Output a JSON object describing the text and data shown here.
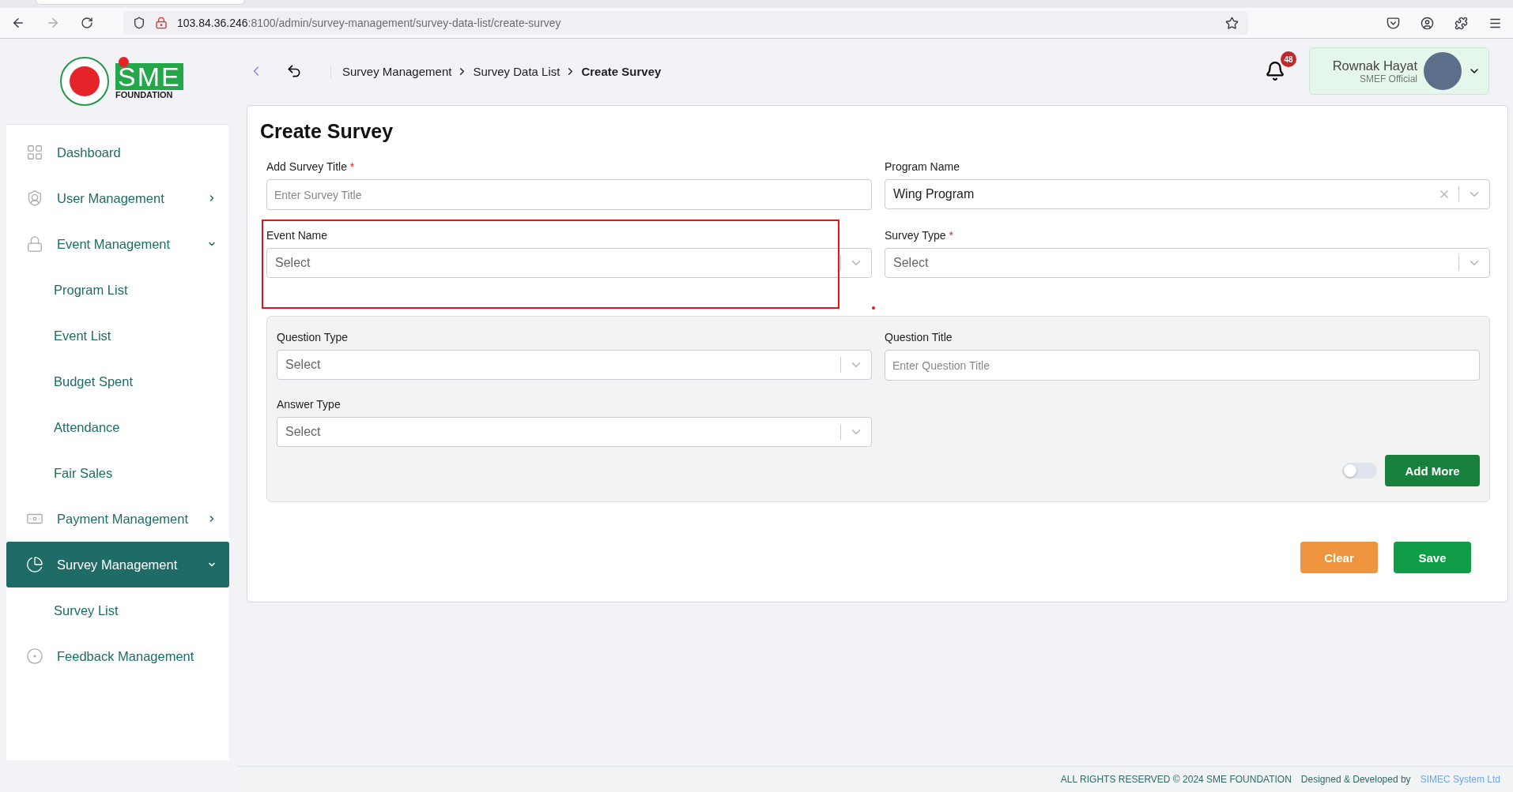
{
  "browser": {
    "url_host": "103.84.36.246",
    "url_rest": ":8100/admin/survey-management/survey-data-list/create-survey"
  },
  "logo": {
    "mark": "SME",
    "subtitle": "FOUNDATION"
  },
  "breadcrumb": [
    {
      "label": "Survey Management",
      "current": false
    },
    {
      "label": "Survey Data List",
      "current": false
    },
    {
      "label": "Create Survey",
      "current": true
    }
  ],
  "notifications": {
    "count": "48"
  },
  "user": {
    "name": "Rownak Hayat",
    "role": "SMEF Official"
  },
  "sidebar": {
    "items": [
      {
        "label": "Dashboard",
        "selected": false
      },
      {
        "label": "User Management",
        "selected": false,
        "expanded": false
      },
      {
        "label": "Event Management",
        "selected": false,
        "expanded": true,
        "children": [
          {
            "label": "Program List"
          },
          {
            "label": "Event List"
          },
          {
            "label": "Budget Spent"
          },
          {
            "label": "Attendance"
          },
          {
            "label": "Fair Sales"
          }
        ]
      },
      {
        "label": "Payment Management",
        "selected": false,
        "expanded": false
      },
      {
        "label": "Survey Management",
        "selected": true,
        "expanded": true,
        "children": [
          {
            "label": "Survey List"
          }
        ]
      },
      {
        "label": "Feedback Management",
        "selected": false
      }
    ]
  },
  "form": {
    "title": "Create Survey",
    "fields": [
      {
        "kind": "text",
        "label": "Add Survey Title",
        "required_mark": "*",
        "placeholder": "Enter Survey Title"
      },
      {
        "kind": "select",
        "label": "Program Name",
        "value": "Wing Program",
        "clearable": true
      },
      {
        "kind": "select",
        "label": "Event Name",
        "placeholder": "Select",
        "highlighted": true
      },
      {
        "kind": "select",
        "label": "Survey Type",
        "required_mark": "*",
        "placeholder": "Select"
      }
    ],
    "question_panel": {
      "fields": [
        {
          "kind": "select",
          "label": "Question Type",
          "placeholder": "Select"
        },
        {
          "kind": "text",
          "label": "Question Title",
          "placeholder": "Enter Question Title"
        },
        {
          "kind": "select",
          "label": "Answer Type",
          "placeholder": "Select"
        }
      ],
      "toggle": {
        "on": false
      },
      "add_button": "Add More"
    },
    "actions": [
      {
        "kind": "clear",
        "label": "Clear"
      },
      {
        "kind": "save",
        "label": "Save"
      }
    ]
  },
  "footer": {
    "rights": "ALL RIGHTS RESERVED © 2024 SME FOUNDATION",
    "credit": "Designed & Developed by",
    "company": "SIMEC System Ltd"
  }
}
